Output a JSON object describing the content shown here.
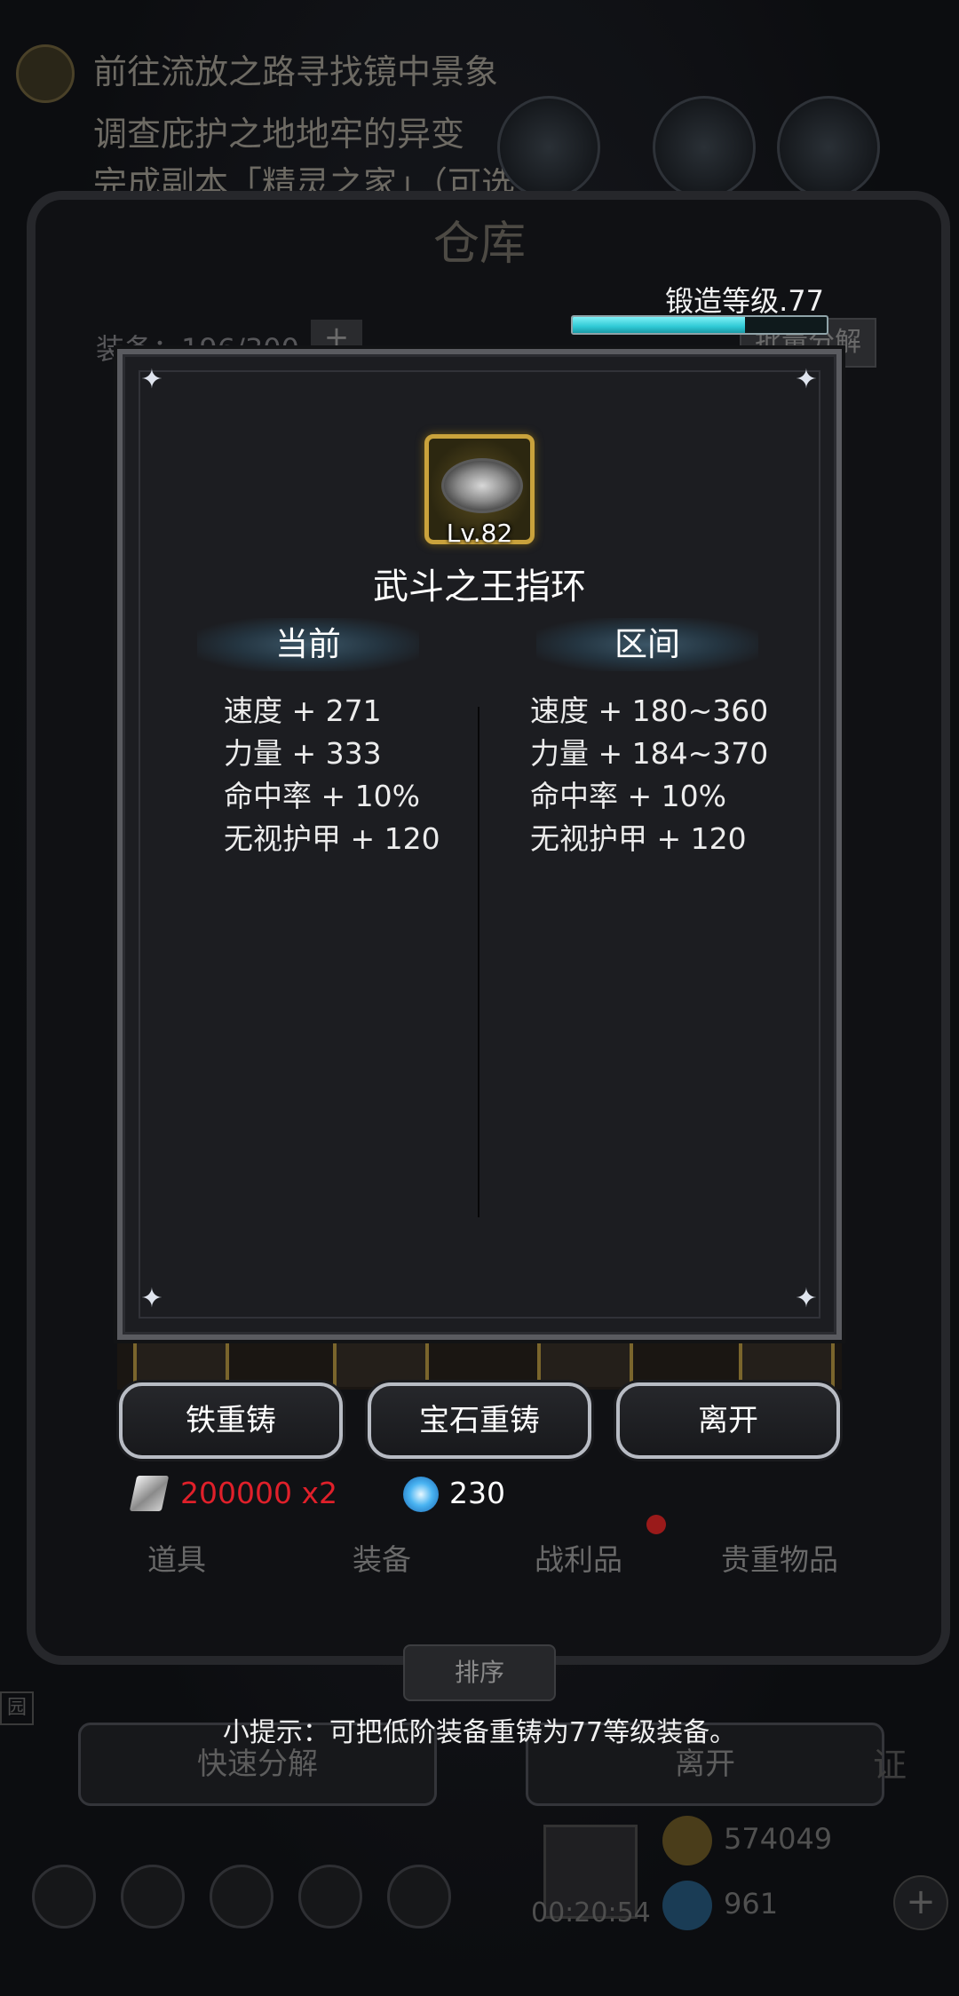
{
  "background": {
    "quests": [
      "前往流放之路寻找镜中景象",
      "调查庇护之地地牢的异变",
      "完成副本「精灵之家」（可选）"
    ],
    "window_title": "仓库",
    "equipment_count": "装备：196/300",
    "plus_label": "+",
    "batch_label": "批量分解",
    "tabs": [
      "道具",
      "装备",
      "战利品",
      "贵重物品"
    ],
    "sort_label": "排序",
    "quick_decompose": "快速分解",
    "leave_label": "离开",
    "timer": "00:20:54",
    "coins": "574049",
    "gems": "961",
    "cert_label": "证"
  },
  "forge": {
    "label": "锻造等级.77",
    "progress": 0.68
  },
  "item": {
    "name": "武斗之王指环",
    "level": "Lv.82",
    "icon": "ring-icon"
  },
  "columns": {
    "current_header": "当前",
    "range_header": "区间",
    "current": [
      "速度 + 271",
      "力量 + 333",
      "命中率 + 10%",
      "无视护甲 + 120"
    ],
    "range": [
      "速度 + 180~360",
      "力量 + 184~370",
      "命中率 + 10%",
      "无视护甲 + 120"
    ]
  },
  "buttons": {
    "iron_reforge": "铁重铸",
    "gem_reforge": "宝石重铸",
    "leave": "离开"
  },
  "cost": {
    "silver": "200000 x2",
    "gem": "230"
  },
  "tip": "小提示：可把低阶装备重铸为77等级装备。",
  "colors": {
    "cost_red": "#e0202a",
    "forge_bar": "#2fc9d5",
    "item_frame": "#c9a23c"
  }
}
